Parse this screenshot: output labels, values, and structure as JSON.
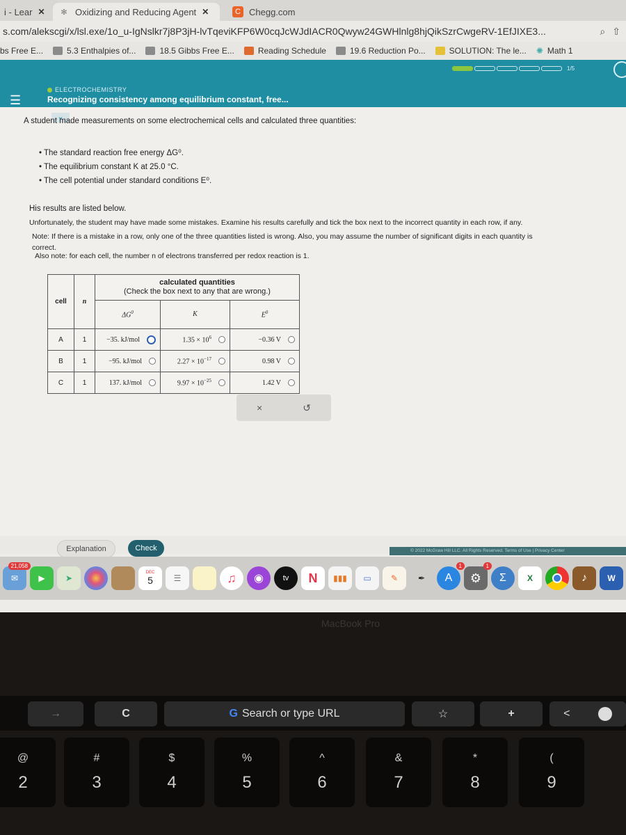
{
  "browser": {
    "tabs": [
      {
        "label": "i - Lear",
        "active": false
      },
      {
        "label": "Oxidizing and Reducing Agent",
        "active": true
      },
      {
        "label": "Chegg.com",
        "active": false
      }
    ],
    "url": "s.com/alekscgi/x/lsl.exe/1o_u-IgNslkr7j8P3jH-lvTqeviKFP6W0cqJcWJdIACR0Qwyw24GWHlnlg8hjQikSzrCwgeRV-1EfJIXE3...",
    "bookmarks": [
      "bs Free E...",
      "5.3 Enthalpies of...",
      "18.5 Gibbs Free E...",
      "Reading Schedule",
      "19.6 Reduction Po...",
      "SOLUTION: The le...",
      "Math 1"
    ]
  },
  "aleks": {
    "topic": "ELECTROCHEMISTRY",
    "title": "Recognizing consistency among equilibrium constant, free...",
    "progress": {
      "completed": 1,
      "total": 5,
      "label": "1/5"
    }
  },
  "question": {
    "intro": "A student made measurements on some electrochemical cells and calculated three quantities:",
    "bullets": [
      "The standard reaction free energy ΔG⁰.",
      "The equilibrium constant K at 25.0 °C.",
      "The cell potential under standard conditions E⁰."
    ],
    "results_listed": "His results are listed below.",
    "instructions_1": "Unfortunately, the student may have made some mistakes. Examine his results carefully and tick the box next to the incorrect quantity in each row, if any.",
    "note_1": "Note: If there is a mistake in a row, only one of the three quantities listed is wrong. Also, you may assume the number of significant digits in each quantity is",
    "note_1b": "correct.",
    "note_2": "Also note: for each cell, the number n of electrons transferred per redox reaction is 1."
  },
  "table": {
    "header_cell": "cell",
    "header_n": "n",
    "calc_title": "calculated quantities",
    "calc_subtitle": "(Check the box next to any that are wrong.)",
    "col_dg": "ΔG",
    "col_k": "K",
    "col_e": "E",
    "sup_zero": "0",
    "rows": [
      {
        "cell": "A",
        "n": "1",
        "dg": "−35. kJ/mol",
        "k_mant": "1.35 × 10",
        "k_exp": "6",
        "e": "−0.36 V"
      },
      {
        "cell": "B",
        "n": "1",
        "dg": "−95. kJ/mol",
        "k_mant": "2.27 × 10",
        "k_exp": "−17",
        "e": "0.98 V"
      },
      {
        "cell": "C",
        "n": "1",
        "dg": "137. kJ/mol",
        "k_mant": "9.97 × 10",
        "k_exp": "−25",
        "e": "1.42 V"
      }
    ]
  },
  "tools": {
    "clear": "×",
    "undo": "↺"
  },
  "buttons": {
    "explanation": "Explanation",
    "check": "Check"
  },
  "footer": "© 2022 McGraw Hill LLC. All Rights Reserved.   Terms of Use  |  Privacy Center",
  "dock": {
    "mail_badge": "21,058",
    "calendar_month": "DEC",
    "calendar_day": "5",
    "appstore_badge": "1",
    "settings_badge": "1",
    "tv_label": "tv"
  },
  "laptop_label": "MacBook Pro",
  "touchbar": {
    "search_placeholder": "Search or type URL",
    "forward": "→",
    "reload": "C",
    "star": "☆",
    "plus": "+",
    "back": "<"
  },
  "keys": [
    {
      "sym": "@",
      "num": "2"
    },
    {
      "sym": "#",
      "num": "3"
    },
    {
      "sym": "$",
      "num": "4"
    },
    {
      "sym": "%",
      "num": "5"
    },
    {
      "sym": "^",
      "num": "6"
    },
    {
      "sym": "&",
      "num": "7"
    },
    {
      "sym": "*",
      "num": "8"
    },
    {
      "sym": "(",
      "num": "9"
    }
  ]
}
